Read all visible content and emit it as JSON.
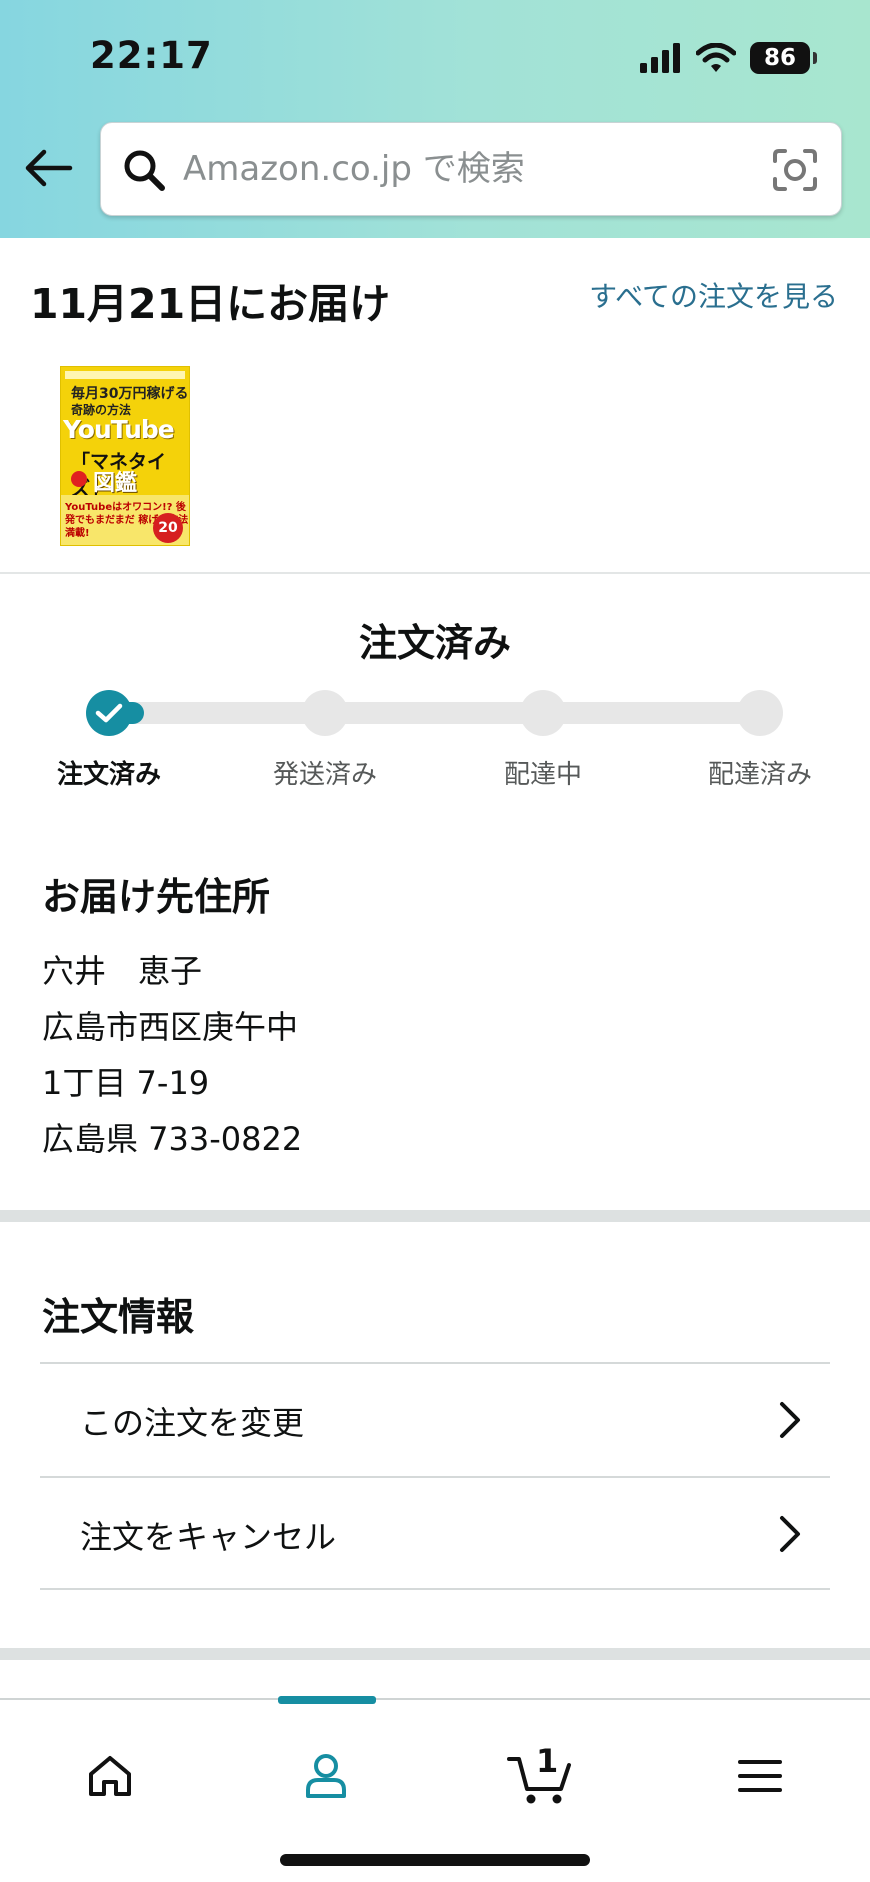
{
  "status_bar": {
    "time": "22:17",
    "battery": "86"
  },
  "search": {
    "placeholder": "Amazon.co.jp で検索"
  },
  "delivery": {
    "title": "11月21日にお届け",
    "all_orders_link": "すべての注文を見る"
  },
  "product": {
    "cover_top": "毎月30万円稼げる",
    "cover_sub": "奇跡の方法",
    "cover_brand": "YouTube",
    "cover_main": "「マネタイズ」",
    "cover_zukan": "図鑑",
    "cover_band": "YouTubeはオワコン!? 後発でもまだまだ 稼げる方法満載!",
    "cover_badge": "20"
  },
  "order_status": {
    "heading": "注文済み",
    "progress": 0.0,
    "steps": [
      {
        "label": "注文済み",
        "done": true
      },
      {
        "label": "発送済み",
        "done": false
      },
      {
        "label": "配達中",
        "done": false
      },
      {
        "label": "配達済み",
        "done": false
      }
    ]
  },
  "address": {
    "title": "お届け先住所",
    "lines": [
      "穴井　恵子",
      "広島市西区庚午中",
      "1丁目 7-19",
      "広島県 733-0822"
    ]
  },
  "order_info": {
    "title": "注文情報",
    "items": [
      {
        "label": "この注文を変更"
      },
      {
        "label": "注文をキャンセル"
      }
    ]
  },
  "bottom_nav": {
    "items": [
      "home-icon",
      "account-icon",
      "cart-icon",
      "menu-icon"
    ],
    "selected": "account-icon",
    "cart_count": "1"
  },
  "colors": {
    "accent": "#168ea2",
    "link": "#2a6f8f",
    "header_start": "#86d6e0",
    "header_end": "#a8e6cf"
  }
}
